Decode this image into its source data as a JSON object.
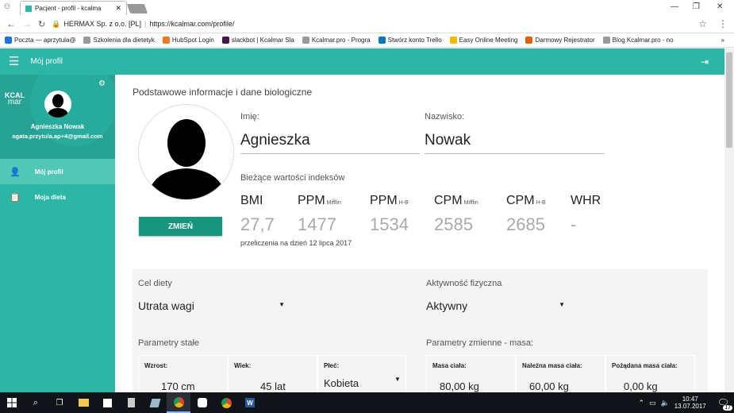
{
  "browser": {
    "tab_title": "Pacjent - profil - kcalma",
    "site_identity": "HERMAX Sp. z o.o. [PL]",
    "url": "https://kcalmar.com/profile/",
    "bookmarks": [
      {
        "label": "Poczta — aprzytula@",
        "color": "#1a73e8"
      },
      {
        "label": "Szkolenia dla dietetyk",
        "color": "#999"
      },
      {
        "label": "HubSpot Login",
        "color": "#f57722"
      },
      {
        "label": "slackbot | Kcalmar Sla",
        "color": "#4a154b"
      },
      {
        "label": "Kcalmar.pro - Progra",
        "color": "#999"
      },
      {
        "label": "Stwórz konto Trello",
        "color": "#0079bf"
      },
      {
        "label": "Easy Online Meeting",
        "color": "#f5b800"
      },
      {
        "label": "Darmowy Rejestrator",
        "color": "#e66000"
      },
      {
        "label": "Blog Kcalmar.pro - no",
        "color": "#999"
      }
    ]
  },
  "app": {
    "header_title": "Mój profil",
    "accent": "#2bb6a6",
    "logo_text_1": "KCAL",
    "logo_text_2": "mar"
  },
  "sidebar": {
    "user_name": "Agnieszka Nowak",
    "user_email": "agata.przytula.ap+4@gmail.com",
    "items": [
      {
        "label": "Mój profil",
        "icon": "person-icon",
        "active": true
      },
      {
        "label": "Moja dieta",
        "icon": "clipboard-icon",
        "active": false
      }
    ]
  },
  "profile": {
    "section_title": "Podstawowe informacje i dane biologiczne",
    "change_button": "ZMIEŃ",
    "first_name_label": "Imię:",
    "first_name": "Agnieszka",
    "last_name_label": "Nazwisko:",
    "last_name": "Nowak",
    "indices_title": "Bieżące wartości indeksów",
    "indices": [
      {
        "name": "BMI",
        "sub": "",
        "value": "27,7"
      },
      {
        "name": "PPM",
        "sub": "Mifflin",
        "value": "1477"
      },
      {
        "name": "PPM",
        "sub": "H-B",
        "value": "1534"
      },
      {
        "name": "CPM",
        "sub": "Mifflin",
        "value": "2585"
      },
      {
        "name": "CPM",
        "sub": "H-B",
        "value": "2685"
      },
      {
        "name": "WHR",
        "sub": "",
        "value": "-"
      }
    ],
    "recalc_note": "przeliczenia na dzień 12 lipca 2017"
  },
  "diet": {
    "goal_label": "Cel diety",
    "goal_value": "Utrata wagi",
    "activity_label": "Aktywność fizyczna",
    "activity_value": "Aktywny",
    "fixed_params_label": "Parametry stałe",
    "variable_params_label": "Parametry zmienne - masa:",
    "fixed": [
      {
        "label": "Wzrost:",
        "value": "170 cm"
      },
      {
        "label": "Wiek:",
        "value": "45 lat"
      },
      {
        "label": "Płeć:",
        "value": "Kobieta"
      }
    ],
    "variable": [
      {
        "label": "Masa ciała:",
        "value": "80,00 kg"
      },
      {
        "label": "Należna masa ciała:",
        "value": "60,00 kg"
      },
      {
        "label": "Pożądana masa ciała:",
        "value": "0,00 kg"
      }
    ]
  },
  "taskbar": {
    "time": "10:47",
    "date": "13.07.2017",
    "notifications": "17"
  }
}
